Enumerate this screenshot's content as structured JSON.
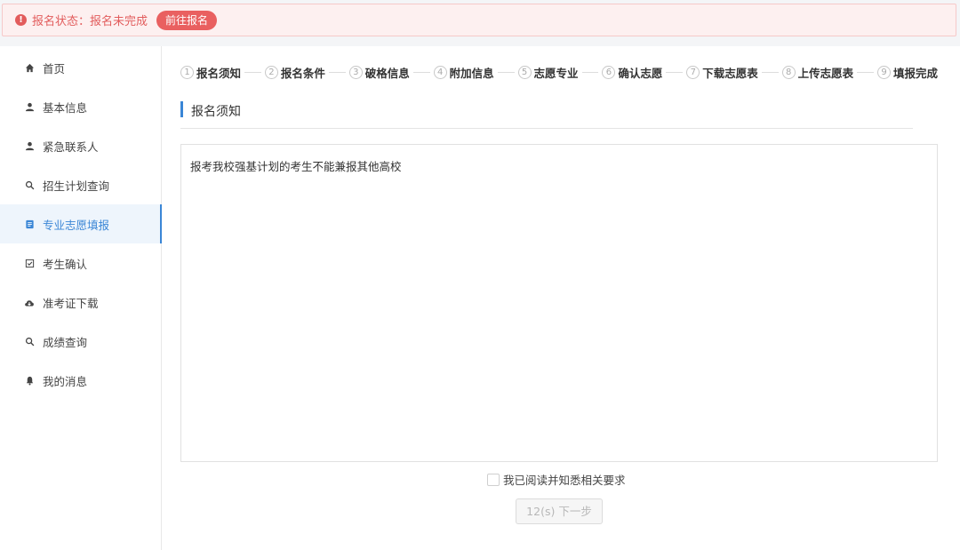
{
  "alert": {
    "icon": "exclamation-icon",
    "text": "报名状态：报名未完成",
    "button_label": "前往报名",
    "color": "#e25c5c"
  },
  "sidebar": {
    "items": [
      {
        "label": "首页",
        "icon": "home-icon"
      },
      {
        "label": "基本信息",
        "icon": "user-icon"
      },
      {
        "label": "紧急联系人",
        "icon": "user-icon"
      },
      {
        "label": "招生计划查询",
        "icon": "search-icon"
      },
      {
        "label": "专业志愿填报",
        "icon": "form-icon",
        "active": true
      },
      {
        "label": "考生确认",
        "icon": "checkbox-icon"
      },
      {
        "label": "准考证下载",
        "icon": "cloud-download-icon"
      },
      {
        "label": "成绩查询",
        "icon": "search-icon"
      },
      {
        "label": "我的消息",
        "icon": "bell-icon"
      }
    ],
    "accent": "#3a86d6"
  },
  "steps": [
    {
      "num": "1",
      "label": "报名须知"
    },
    {
      "num": "2",
      "label": "报名条件"
    },
    {
      "num": "3",
      "label": "破格信息"
    },
    {
      "num": "4",
      "label": "附加信息"
    },
    {
      "num": "5",
      "label": "志愿专业"
    },
    {
      "num": "6",
      "label": "确认志愿"
    },
    {
      "num": "7",
      "label": "下载志愿表"
    },
    {
      "num": "8",
      "label": "上传志愿表"
    },
    {
      "num": "9",
      "label": "填报完成"
    }
  ],
  "section": {
    "title": "报名须知"
  },
  "notice": {
    "text": "报考我校强基计划的考生不能兼报其他高校"
  },
  "agree": {
    "label": "我已阅读并知悉相关要求",
    "checked": false
  },
  "next_button": {
    "label": "12(s) 下一步"
  }
}
